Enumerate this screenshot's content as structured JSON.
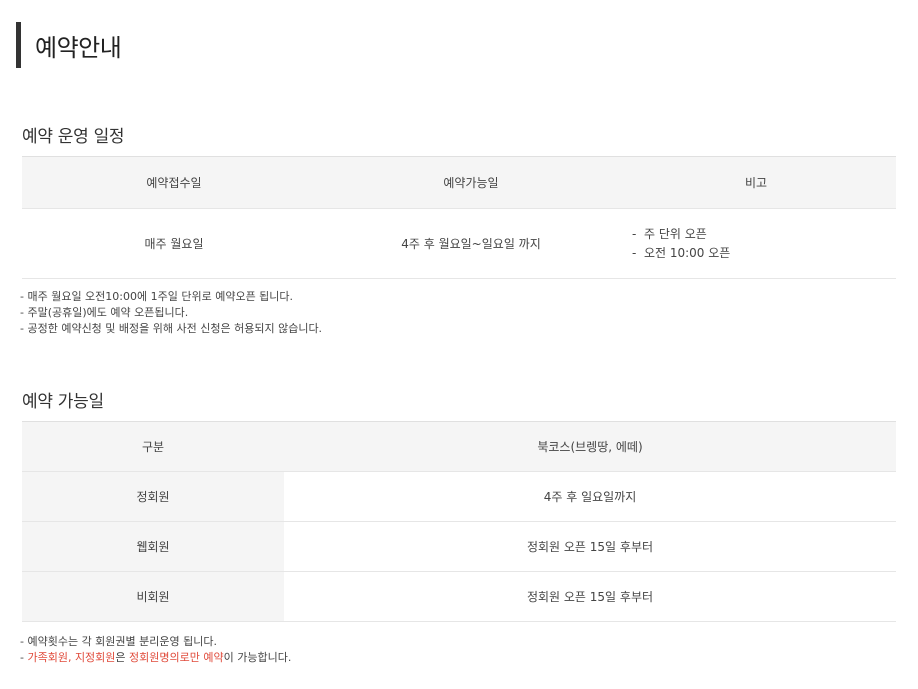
{
  "page": {
    "title": "예약안내"
  },
  "schedule": {
    "heading": "예약 운영 일정",
    "columns": [
      "예약접수일",
      "예약가능일",
      "비고"
    ],
    "row": {
      "reception_day": "매주 월요일",
      "available_days": "4주 후 월요일~일요일 까지",
      "notes": [
        "주 단위 오픈",
        "오전 10:00 오픈"
      ]
    },
    "bullets": [
      "매주 월요일 오전10:00에 1주일 단위로 예약오픈 됩니다.",
      "주말(공휴일)에도 예약 오픈됩니다.",
      "공정한 예약신청 및 배정을 위해 사전 신청은 허용되지 않습니다."
    ]
  },
  "availability": {
    "heading": "예약 가능일",
    "columns": [
      "구분",
      "북코스(브렝땅, 에떼)"
    ],
    "rows": [
      {
        "category": "정회원",
        "value": "4주 후 일요일까지"
      },
      {
        "category": "웹회원",
        "value": "정회원 오픈 15일 후부터"
      },
      {
        "category": "비회원",
        "value": "정회원 오픈 15일 후부터"
      }
    ],
    "bullet1": "예약횟수는 각 회원권별 분리운영 됩니다.",
    "bullet2": {
      "part1": "가족회원, 지정회원",
      "part2": "은 ",
      "part3": "정회원명의로만 예약",
      "part4": "이 가능합니다."
    },
    "accent_color": "#e04a3a"
  }
}
